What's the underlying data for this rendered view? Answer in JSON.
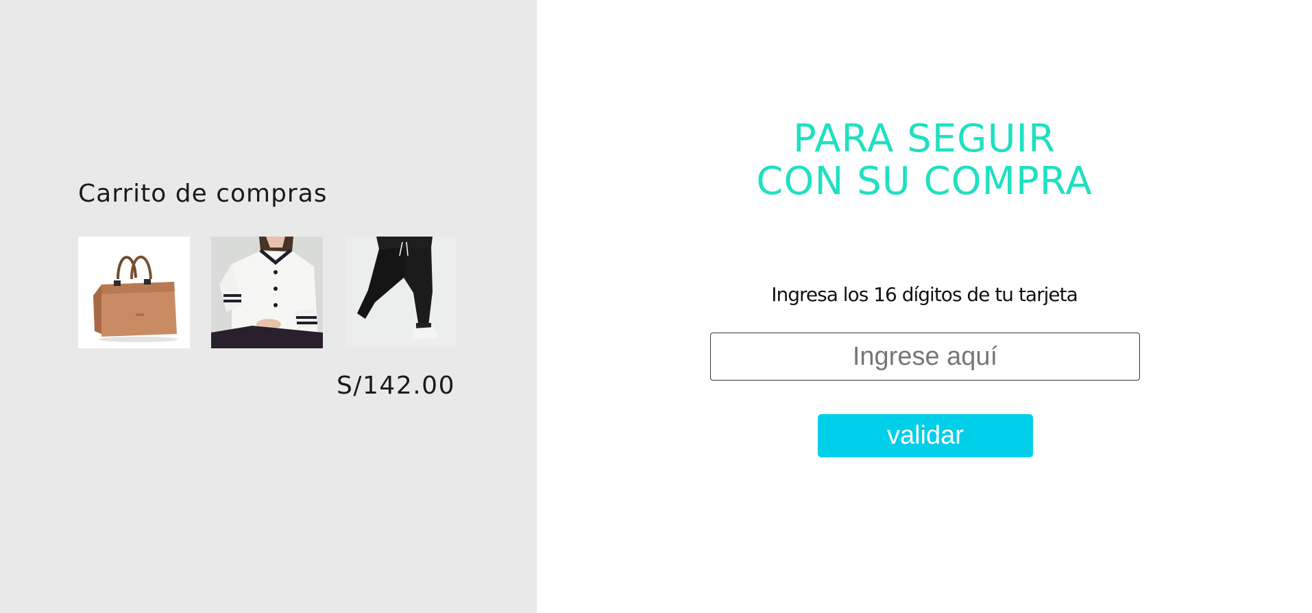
{
  "cart": {
    "title": "Carrito de compras",
    "items": [
      {
        "icon": "handbag-image"
      },
      {
        "icon": "white-blouse-image"
      },
      {
        "icon": "black-pants-image"
      }
    ],
    "total": "S/142.00"
  },
  "checkout": {
    "headline_line1": "PARA SEGUIR",
    "headline_line2": "CON SU COMPRA",
    "prompt": "Ingresa los 16 dígitos de tu tarjeta",
    "card_input": {
      "placeholder": "Ingrese aquí",
      "value": ""
    },
    "validate_label": "validar"
  },
  "colors": {
    "left_panel_bg": "#e9e9e9",
    "headline": "#1fe0c1",
    "button_bg": "#00cfea",
    "button_text": "#ffffff"
  }
}
